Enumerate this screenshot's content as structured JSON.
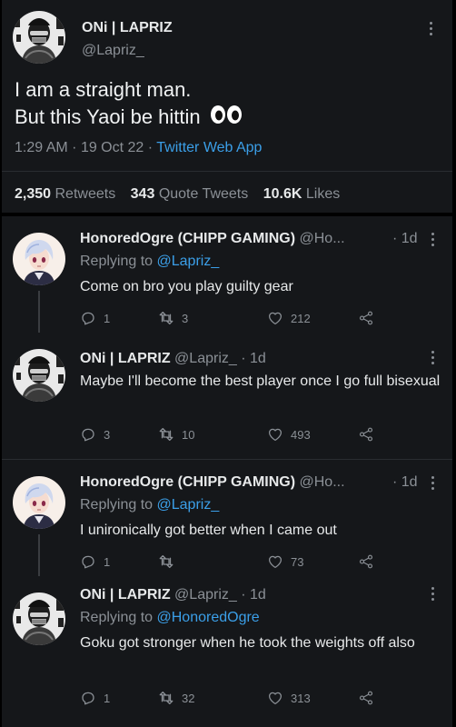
{
  "main_tweet": {
    "author_name": "ONi | LAPRIZ",
    "author_handle": "@Lapriz_",
    "text_line1": "I am a straight man.",
    "text_line2": "But this Yaoi be hittin",
    "emoji": "eyes-emoji",
    "time": "1:29 AM",
    "date": "19 Oct 22",
    "app": "Twitter Web App",
    "retweets_count": "2,350",
    "retweets_label": "Retweets",
    "quotes_count": "343",
    "quotes_label": "Quote Tweets",
    "likes_count": "10.6K",
    "likes_label": "Likes"
  },
  "replies": [
    {
      "author_name": "HonoredOgre (CHIPP GAMING)",
      "author_handle": "@Ho...",
      "time": "· 1d",
      "replying_prefix": "Replying to",
      "replying_to": "@Lapriz_",
      "text": "Come on bro you play guilty gear",
      "reply_count": "1",
      "retweet_count": "3",
      "like_count": "212",
      "avatar": "anime-avatar"
    },
    {
      "author_name": "ONi | LAPRIZ",
      "author_handle": "@Lapriz_",
      "time": "· 1d",
      "text": "Maybe I'll become the best player once I go full bisexual",
      "reply_count": "3",
      "retweet_count": "10",
      "like_count": "493",
      "avatar": "mask-avatar"
    },
    {
      "author_name": "HonoredOgre (CHIPP GAMING)",
      "author_handle": "@Ho...",
      "time": "· 1d",
      "replying_prefix": "Replying to",
      "replying_to": "@Lapriz_",
      "text": "I unironically got better when I came out",
      "reply_count": "1",
      "retweet_count": "",
      "like_count": "73",
      "avatar": "anime-avatar"
    },
    {
      "author_name": "ONi | LAPRIZ",
      "author_handle": "@Lapriz_",
      "time": "· 1d",
      "replying_prefix": "Replying to",
      "replying_to": "@HonoredOgre",
      "text": "Goku got stronger when he took the weights off also",
      "reply_count": "1",
      "retweet_count": "32",
      "like_count": "313",
      "avatar": "mask-avatar"
    }
  ],
  "colors": {
    "background": "#000000",
    "card": "#15171a",
    "text": "#e7e9ea",
    "secondary": "#8b9096",
    "link": "#3b9fe8"
  }
}
